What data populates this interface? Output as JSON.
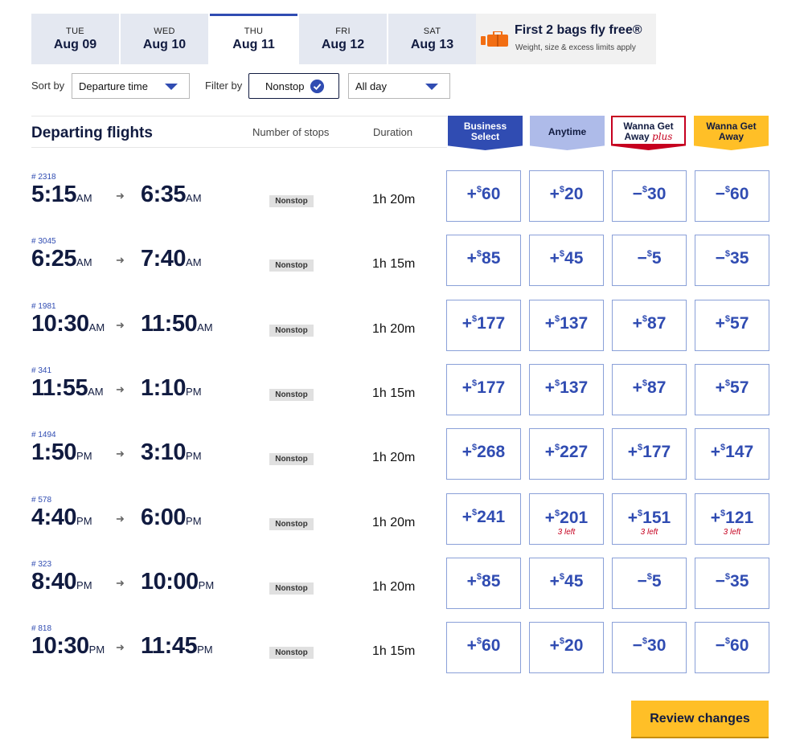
{
  "date_tabs": [
    {
      "dow": "TUE",
      "date": "Aug 09",
      "active": false
    },
    {
      "dow": "WED",
      "date": "Aug 10",
      "active": false
    },
    {
      "dow": "THU",
      "date": "Aug 11",
      "active": true
    },
    {
      "dow": "FRI",
      "date": "Aug 12",
      "active": false
    },
    {
      "dow": "SAT",
      "date": "Aug 13",
      "active": false
    }
  ],
  "bags": {
    "title": "First 2 bags fly free®",
    "subtitle": "Weight, size & excess limits apply",
    "icon": "suitcase-icon"
  },
  "filters": {
    "sort_label": "Sort by",
    "sort_value": "Departure time",
    "filter_label": "Filter by",
    "stops_value": "Nonstop",
    "time_value": "All day"
  },
  "header": {
    "title": "Departing flights",
    "stops_col": "Number of stops",
    "duration_col": "Duration",
    "fares": {
      "business": [
        "Business",
        "Select"
      ],
      "anytime": "Anytime",
      "wga_plus": [
        "Wanna Get",
        "Away",
        "plus"
      ],
      "wga": [
        "Wanna Get",
        "Away"
      ]
    }
  },
  "flights": [
    {
      "num": "# 2318",
      "dep": "5:15",
      "dep_ap": "AM",
      "arr": "6:35",
      "arr_ap": "AM",
      "stops": "Nonstop",
      "duration": "1h 20m",
      "fares": [
        {
          "sign": "+",
          "amt": "60"
        },
        {
          "sign": "+",
          "amt": "20"
        },
        {
          "sign": "−",
          "amt": "30"
        },
        {
          "sign": "−",
          "amt": "60"
        }
      ]
    },
    {
      "num": "# 3045",
      "dep": "6:25",
      "dep_ap": "AM",
      "arr": "7:40",
      "arr_ap": "AM",
      "stops": "Nonstop",
      "duration": "1h 15m",
      "fares": [
        {
          "sign": "+",
          "amt": "85"
        },
        {
          "sign": "+",
          "amt": "45"
        },
        {
          "sign": "−",
          "amt": "5"
        },
        {
          "sign": "−",
          "amt": "35"
        }
      ]
    },
    {
      "num": "# 1981",
      "dep": "10:30",
      "dep_ap": "AM",
      "arr": "11:50",
      "arr_ap": "AM",
      "stops": "Nonstop",
      "duration": "1h 20m",
      "fares": [
        {
          "sign": "+",
          "amt": "177"
        },
        {
          "sign": "+",
          "amt": "137"
        },
        {
          "sign": "+",
          "amt": "87"
        },
        {
          "sign": "+",
          "amt": "57"
        }
      ]
    },
    {
      "num": "# 341",
      "dep": "11:55",
      "dep_ap": "AM",
      "arr": "1:10",
      "arr_ap": "PM",
      "stops": "Nonstop",
      "duration": "1h 15m",
      "fares": [
        {
          "sign": "+",
          "amt": "177"
        },
        {
          "sign": "+",
          "amt": "137"
        },
        {
          "sign": "+",
          "amt": "87"
        },
        {
          "sign": "+",
          "amt": "57"
        }
      ]
    },
    {
      "num": "# 1494",
      "dep": "1:50",
      "dep_ap": "PM",
      "arr": "3:10",
      "arr_ap": "PM",
      "stops": "Nonstop",
      "duration": "1h 20m",
      "fares": [
        {
          "sign": "+",
          "amt": "268"
        },
        {
          "sign": "+",
          "amt": "227"
        },
        {
          "sign": "+",
          "amt": "177"
        },
        {
          "sign": "+",
          "amt": "147"
        }
      ]
    },
    {
      "num": "# 578",
      "dep": "4:40",
      "dep_ap": "PM",
      "arr": "6:00",
      "arr_ap": "PM",
      "stops": "Nonstop",
      "duration": "1h 20m",
      "fares": [
        {
          "sign": "+",
          "amt": "241"
        },
        {
          "sign": "+",
          "amt": "201",
          "left": "3 left"
        },
        {
          "sign": "+",
          "amt": "151",
          "left": "3 left"
        },
        {
          "sign": "+",
          "amt": "121",
          "left": "3 left"
        }
      ]
    },
    {
      "num": "# 323",
      "dep": "8:40",
      "dep_ap": "PM",
      "arr": "10:00",
      "arr_ap": "PM",
      "stops": "Nonstop",
      "duration": "1h 20m",
      "fares": [
        {
          "sign": "+",
          "amt": "85"
        },
        {
          "sign": "+",
          "amt": "45"
        },
        {
          "sign": "−",
          "amt": "5"
        },
        {
          "sign": "−",
          "amt": "35"
        }
      ]
    },
    {
      "num": "# 818",
      "dep": "10:30",
      "dep_ap": "PM",
      "arr": "11:45",
      "arr_ap": "PM",
      "stops": "Nonstop",
      "duration": "1h 15m",
      "fares": [
        {
          "sign": "+",
          "amt": "60"
        },
        {
          "sign": "+",
          "amt": "20"
        },
        {
          "sign": "−",
          "amt": "30"
        },
        {
          "sign": "−",
          "amt": "60"
        }
      ]
    }
  ],
  "currency_symbol": "$",
  "review_button": "Review changes",
  "colors": {
    "brand_blue": "#304cb2",
    "navy": "#111b40",
    "gold": "#ffbf27",
    "red": "#c6001f"
  }
}
